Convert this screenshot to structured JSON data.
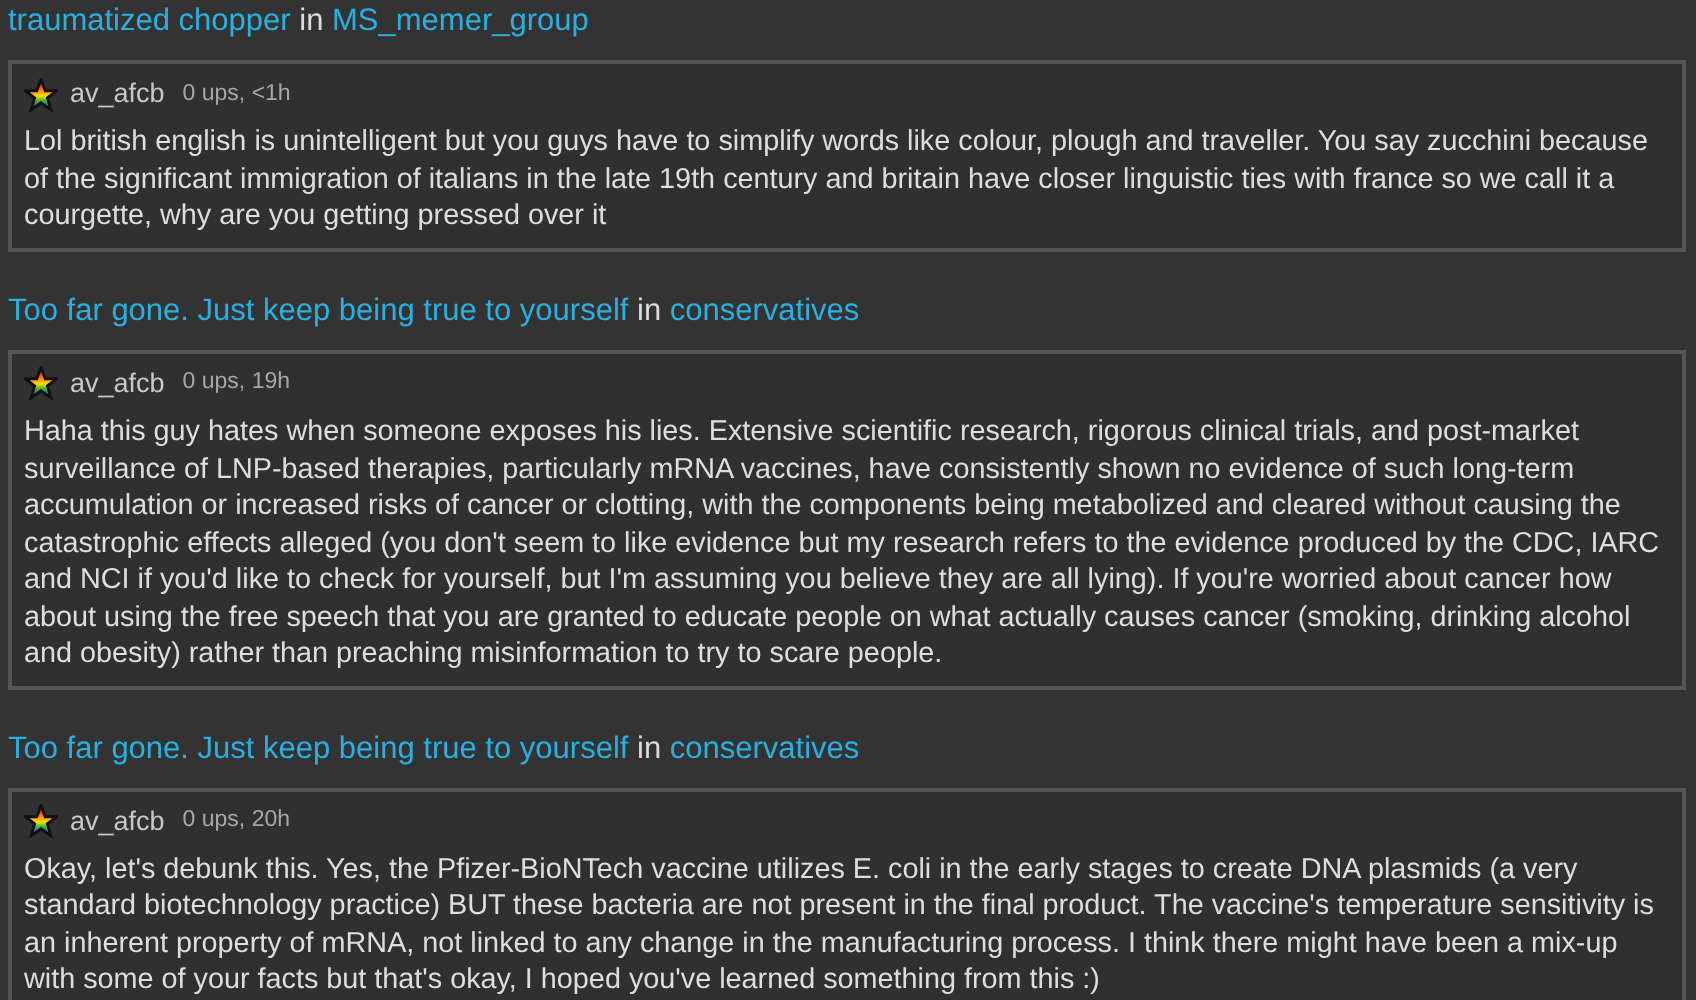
{
  "posts": [
    {
      "title": "traumatized chopper",
      "joiner": "in",
      "group": "MS_memer_group",
      "comment": {
        "user": "av_afcb",
        "meta": "0 ups, <1h",
        "text": "Lol british english is unintelligent but you guys have to simplify words like colour, plough and traveller. You say zucchini because of the significant immigration of italians in the late 19th century and britain have closer linguistic ties with france so we call it a courgette, why are you getting pressed over it"
      }
    },
    {
      "title": "Too far gone. Just keep being true to yourself",
      "joiner": "in",
      "group": "conservatives",
      "comment": {
        "user": "av_afcb",
        "meta": "0 ups, 19h",
        "text": "Haha this guy hates when someone exposes his lies. Extensive scientific research, rigorous clinical trials, and post-market surveillance of LNP-based therapies, particularly mRNA vaccines, have consistently shown no evidence of such long-term accumulation or increased risks of cancer or clotting, with the components being metabolized and cleared without causing the catastrophic effects alleged (you don't seem to like evidence but my research refers to the evidence produced by the CDC, IARC and NCI if you'd like to check for yourself, but I'm assuming you believe they are all lying). If you're worried about cancer how about using the free speech that you are granted to educate people on what actually causes cancer (smoking, drinking alcohol and obesity) rather than preaching misinformation to try to scare people."
      }
    },
    {
      "title": "Too far gone. Just keep being true to yourself",
      "joiner": "in",
      "group": "conservatives",
      "comment": {
        "user": "av_afcb",
        "meta": "0 ups, 20h",
        "text": "Okay, let's debunk this. Yes, the Pfizer-BioNTech vaccine utilizes E. coli in the early stages to create DNA plasmids (a very standard biotechnology practice) BUT these bacteria are not present in the final product. The vaccine's temperature sensitivity is an inherent property of mRNA, not linked to any change in the manufacturing process. I think there might have been a mix-up with some of your facts but that's okay, I hoped you've learned something from this :)"
      }
    }
  ]
}
